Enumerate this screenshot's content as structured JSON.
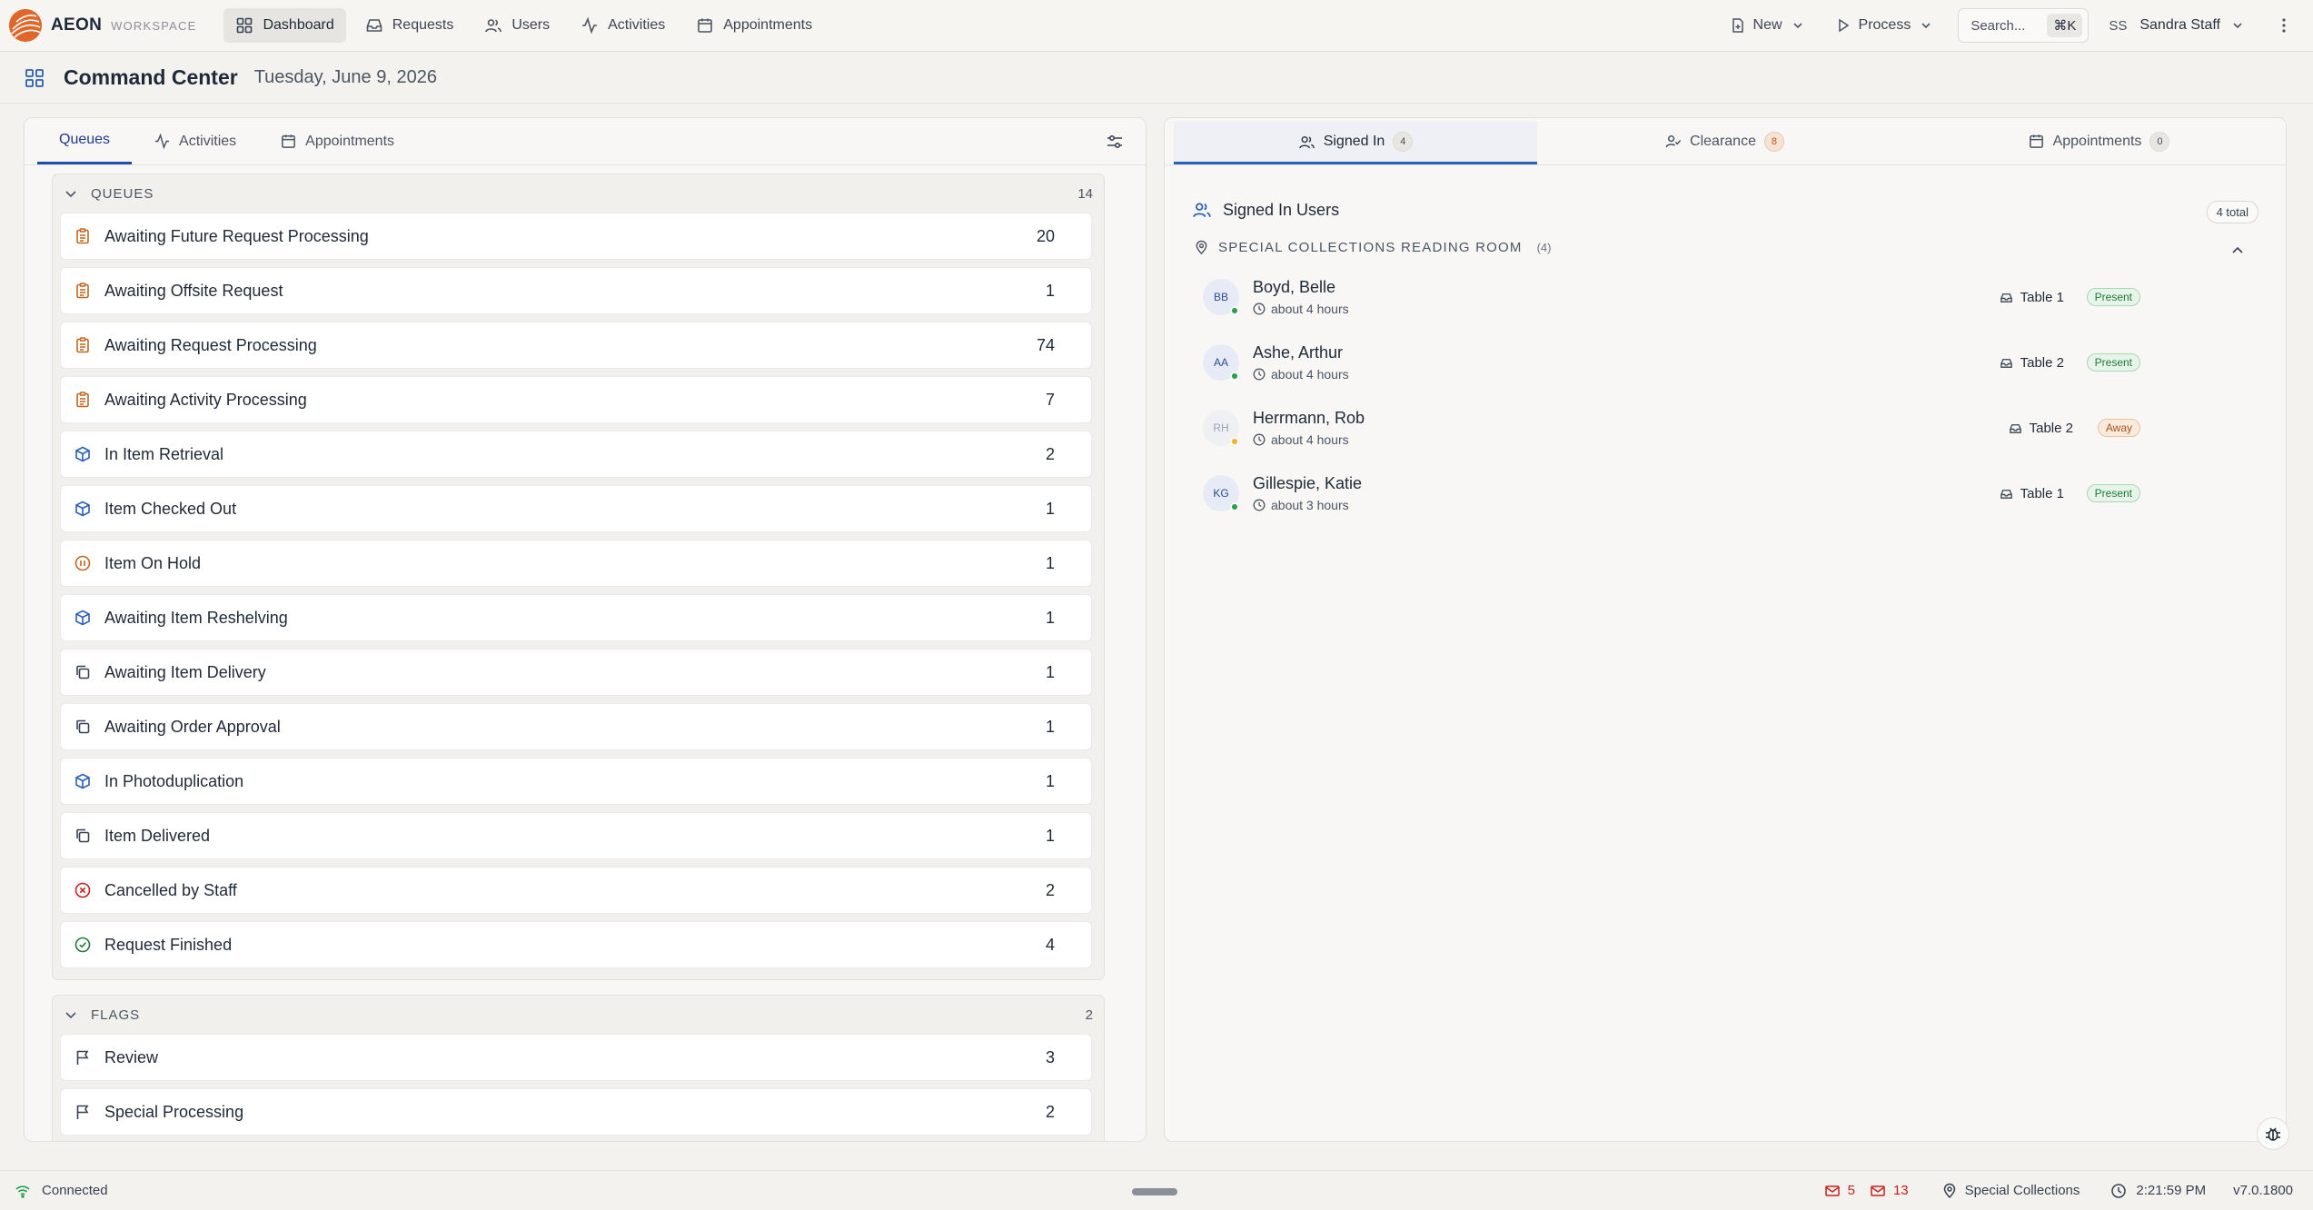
{
  "app": {
    "name": "AEON",
    "subtitle": "WORKSPACE",
    "accent": "#e0672a"
  },
  "nav": [
    {
      "label": "Dashboard",
      "icon": "dashboard-icon",
      "active": true
    },
    {
      "label": "Requests",
      "icon": "inbox-icon"
    },
    {
      "label": "Users",
      "icon": "users-icon"
    },
    {
      "label": "Activities",
      "icon": "activity-icon"
    },
    {
      "label": "Appointments",
      "icon": "calendar-icon"
    }
  ],
  "toolbar": {
    "new_label": "New",
    "process_label": "Process",
    "search_placeholder": "Search...",
    "search_shortcut": "⌘K"
  },
  "user": {
    "initials": "SS",
    "name": "Sandra Staff"
  },
  "page": {
    "title": "Command Center",
    "date": "Tuesday, June 9, 2026"
  },
  "left_tabs": [
    {
      "label": "Queues",
      "active": true
    },
    {
      "label": "Activities"
    },
    {
      "label": "Appointments"
    }
  ],
  "queues": {
    "title": "QUEUES",
    "count": "14",
    "items": [
      {
        "label": "Awaiting Future Request Processing",
        "count": "20",
        "icon": "clipboard-icon"
      },
      {
        "label": "Awaiting Offsite Request",
        "count": "1",
        "icon": "clipboard-icon"
      },
      {
        "label": "Awaiting Request Processing",
        "count": "74",
        "icon": "clipboard-icon"
      },
      {
        "label": "Awaiting Activity Processing",
        "count": "7",
        "icon": "clipboard-icon"
      },
      {
        "label": "In Item Retrieval",
        "count": "2",
        "icon": "box-icon"
      },
      {
        "label": "Item Checked Out",
        "count": "1",
        "icon": "box-icon"
      },
      {
        "label": "Item On Hold",
        "count": "1",
        "icon": "pause-icon"
      },
      {
        "label": "Awaiting Item Reshelving",
        "count": "1",
        "icon": "box-icon"
      },
      {
        "label": "Awaiting Item Delivery",
        "count": "1",
        "icon": "copy-icon"
      },
      {
        "label": "Awaiting Order Approval",
        "count": "1",
        "icon": "copy-icon"
      },
      {
        "label": "In Photoduplication",
        "count": "1",
        "icon": "box-icon"
      },
      {
        "label": "Item Delivered",
        "count": "1",
        "icon": "copy-icon"
      },
      {
        "label": "Cancelled by Staff",
        "count": "2",
        "icon": "x-circle-icon"
      },
      {
        "label": "Request Finished",
        "count": "4",
        "icon": "check-circle-icon"
      }
    ]
  },
  "flags": {
    "title": "FLAGS",
    "count": "2",
    "items": [
      {
        "label": "Review",
        "count": "3",
        "icon": "flag-icon"
      },
      {
        "label": "Special Processing",
        "count": "2",
        "icon": "flag-icon"
      }
    ]
  },
  "right_tabs": [
    {
      "label": "Signed In",
      "count": "4",
      "active": true
    },
    {
      "label": "Clearance",
      "count": "8"
    },
    {
      "label": "Appointments",
      "count": "0"
    }
  ],
  "signed_in": {
    "title": "Signed In Users",
    "total": "4 total",
    "room": "SPECIAL COLLECTIONS READING ROOM",
    "room_count": "(4)",
    "users": [
      {
        "initials": "BB",
        "name": "Boyd, Belle",
        "time": "about 4 hours",
        "table": "Table 1",
        "status": "Present"
      },
      {
        "initials": "AA",
        "name": "Ashe, Arthur",
        "time": "about 4 hours",
        "table": "Table 2",
        "status": "Present"
      },
      {
        "initials": "RH",
        "name": "Herrmann, Rob",
        "time": "about 4 hours",
        "table": "Table 2",
        "status": "Away"
      },
      {
        "initials": "KG",
        "name": "Gillespie, Katie",
        "time": "about 3 hours",
        "table": "Table 1",
        "status": "Present"
      }
    ]
  },
  "statusbar": {
    "connection": "Connected",
    "mail_unread": "5",
    "mail_alerts": "13",
    "location": "Special Collections",
    "time": "2:21:59 PM",
    "version": "v7.0.1800"
  },
  "colors": {
    "present": "#22a04b",
    "away": "#f0b323",
    "danger": "#c81e1e",
    "brand": "#e0672a"
  }
}
